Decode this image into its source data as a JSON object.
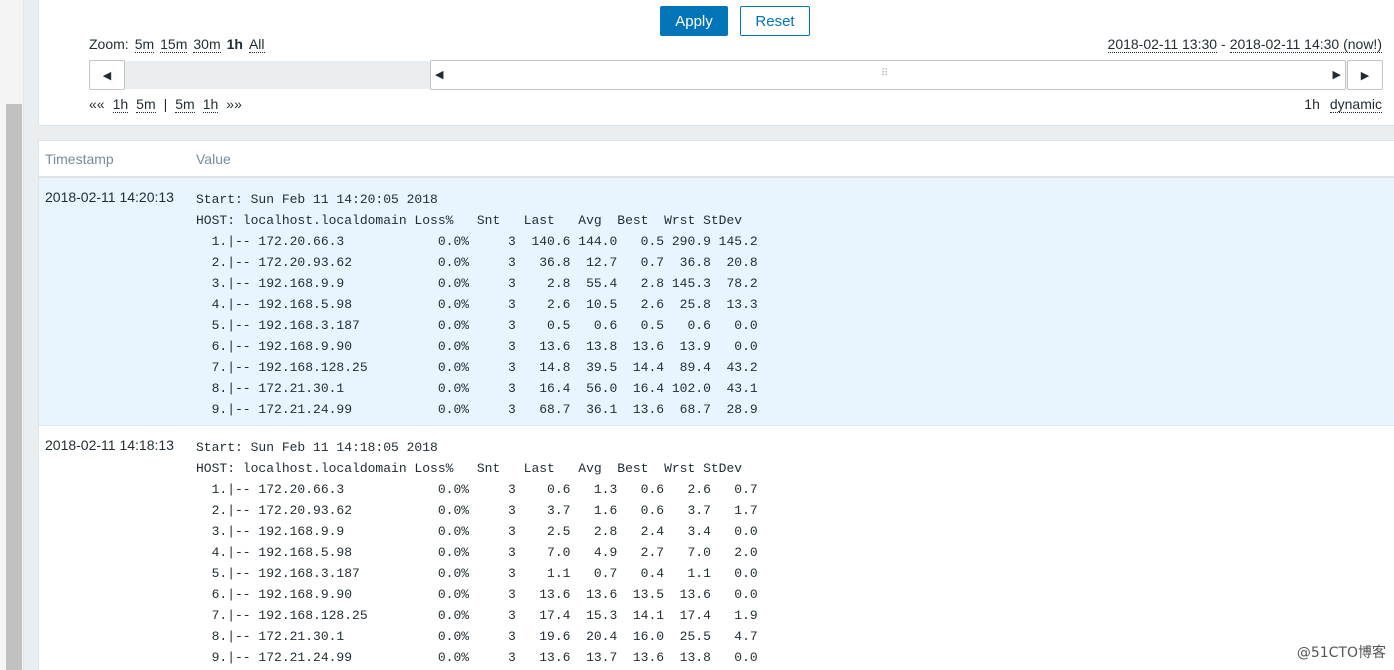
{
  "filter": {
    "apply_label": "Apply",
    "reset_label": "Reset",
    "zoom_label": "Zoom:",
    "zoom_options": [
      "5m",
      "15m",
      "30m",
      "1h",
      "All"
    ],
    "zoom_active": "1h",
    "range_from": "2018-02-11 13:30",
    "range_separator": "-",
    "range_to": "2018-02-11 14:30 (now!)",
    "nav_left": [
      "««",
      "1h",
      "5m",
      "|",
      "5m",
      "1h",
      "»»"
    ],
    "period": "1h",
    "dynamic_label": "dynamic"
  },
  "table": {
    "columns": [
      "Timestamp",
      "Value"
    ],
    "rows": [
      {
        "timestamp": "2018-02-11 14:20:13",
        "value": "Start: Sun Feb 11 14:20:05 2018\nHOST: localhost.localdomain Loss%   Snt   Last   Avg  Best  Wrst StDev\n  1.|-- 172.20.66.3            0.0%     3  140.6 144.0   0.5 290.9 145.2\n  2.|-- 172.20.93.62           0.0%     3   36.8  12.7   0.7  36.8  20.8\n  3.|-- 192.168.9.9            0.0%     3    2.8  55.4   2.8 145.3  78.2\n  4.|-- 192.168.5.98           0.0%     3    2.6  10.5   2.6  25.8  13.3\n  5.|-- 192.168.3.187          0.0%     3    0.5   0.6   0.5   0.6   0.0\n  6.|-- 192.168.9.90           0.0%     3   13.6  13.8  13.6  13.9   0.0\n  7.|-- 192.168.128.25         0.0%     3   14.8  39.5  14.4  89.4  43.2\n  8.|-- 172.21.30.1            0.0%     3   16.4  56.0  16.4 102.0  43.1\n  9.|-- 172.21.24.99           0.0%     3   68.7  36.1  13.6  68.7  28.9"
      },
      {
        "timestamp": "2018-02-11 14:18:13",
        "value": "Start: Sun Feb 11 14:18:05 2018\nHOST: localhost.localdomain Loss%   Snt   Last   Avg  Best  Wrst StDev\n  1.|-- 172.20.66.3            0.0%     3    0.6   1.3   0.6   2.6   0.7\n  2.|-- 172.20.93.62           0.0%     3    3.7   1.6   0.6   3.7   1.7\n  3.|-- 192.168.9.9            0.0%     3    2.5   2.8   2.4   3.4   0.0\n  4.|-- 192.168.5.98           0.0%     3    7.0   4.9   2.7   7.0   2.0\n  5.|-- 192.168.3.187          0.0%     3    1.1   0.7   0.4   1.1   0.0\n  6.|-- 192.168.9.90           0.0%     3   13.6  13.6  13.5  13.6   0.0\n  7.|-- 192.168.128.25         0.0%     3   17.4  15.3  14.1  17.4   1.9\n  8.|-- 172.21.30.1            0.0%     3   19.6  20.4  16.0  25.5   4.7\n  9.|-- 172.21.24.99           0.0%     3   13.6  13.7  13.6  13.8   0.0"
      }
    ]
  },
  "watermark": "@51CTO博客",
  "icons": {
    "timeline_back": "caret-left-icon",
    "timeline_forward": "caret-right-icon",
    "selection_grip": "drag-handle-icon"
  },
  "colors": {
    "primary": "#0275b8",
    "row_highlight": "#e8f5ff",
    "header_text": "#768d99"
  }
}
